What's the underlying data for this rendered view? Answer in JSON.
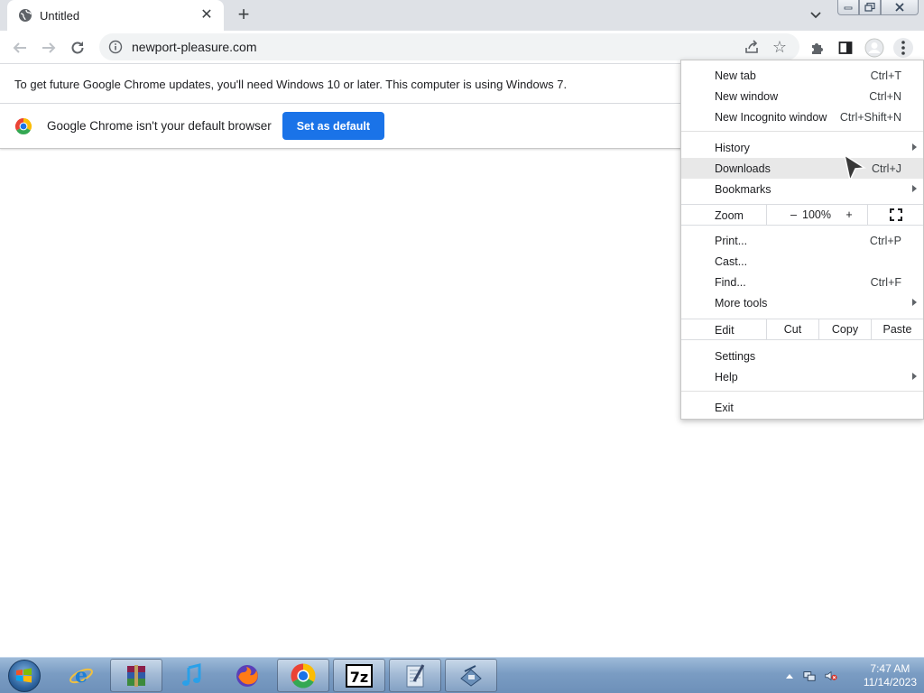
{
  "tab": {
    "title": "Untitled"
  },
  "omnibox": {
    "url": "newport-pleasure.com"
  },
  "infobars": {
    "update_message": "To get future Google Chrome updates, you'll need Windows 10 or later. This computer is using Windows 7.",
    "default_browser_message": "Google Chrome isn't your default browser",
    "set_default_label": "Set as default"
  },
  "menu": {
    "new_tab": {
      "label": "New tab",
      "shortcut": "Ctrl+T"
    },
    "new_window": {
      "label": "New window",
      "shortcut": "Ctrl+N"
    },
    "new_incognito": {
      "label": "New Incognito window",
      "shortcut": "Ctrl+Shift+N"
    },
    "history": {
      "label": "History"
    },
    "downloads": {
      "label": "Downloads",
      "shortcut": "Ctrl+J"
    },
    "bookmarks": {
      "label": "Bookmarks"
    },
    "zoom": {
      "label": "Zoom",
      "minus": "–",
      "value": "100%",
      "plus": "+"
    },
    "print": {
      "label": "Print...",
      "shortcut": "Ctrl+P"
    },
    "cast": {
      "label": "Cast..."
    },
    "find": {
      "label": "Find...",
      "shortcut": "Ctrl+F"
    },
    "more_tools": {
      "label": "More tools"
    },
    "edit": {
      "label": "Edit",
      "cut": "Cut",
      "copy": "Copy",
      "paste": "Paste"
    },
    "settings": {
      "label": "Settings"
    },
    "help": {
      "label": "Help"
    },
    "exit": {
      "label": "Exit"
    },
    "highlighted_item": "downloads"
  },
  "taskbar": {
    "apps": [
      "internet-explorer",
      "winrar",
      "itunes",
      "firefox",
      "chrome",
      "7zip",
      "notepad-editor",
      "network-tool"
    ],
    "active": [
      "winrar",
      "chrome",
      "7zip",
      "notepad-editor",
      "network-tool"
    ]
  },
  "clock": {
    "time": "7:47 AM",
    "date": "11/14/2023"
  },
  "colors": {
    "accent": "#1a73e8",
    "tabstrip": "#dee1e6",
    "taskbar": "#7a9cc3"
  }
}
